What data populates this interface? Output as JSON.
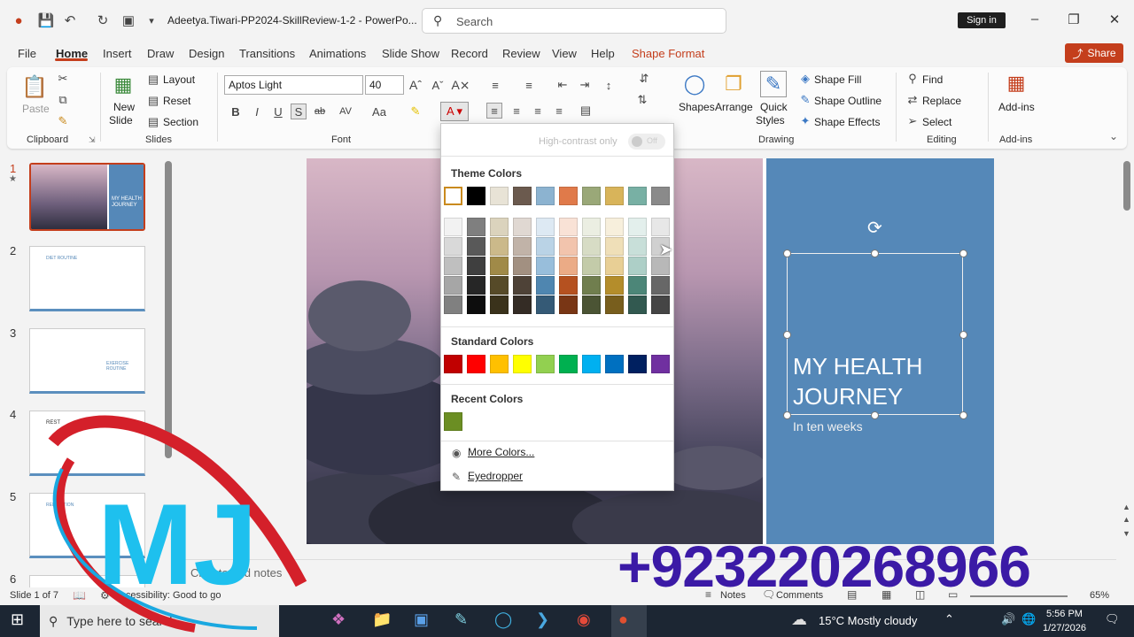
{
  "app": {
    "document_title": "Adeetya.Tiwari-PP2024-SkillReview-1-2  -  PowerPo...",
    "search_placeholder": "Search",
    "sign_in": "Sign in"
  },
  "menu": {
    "tabs": [
      "File",
      "Home",
      "Insert",
      "Draw",
      "Design",
      "Transitions",
      "Animations",
      "Slide Show",
      "Record",
      "Review",
      "View",
      "Help",
      "Shape Format"
    ],
    "share": "Share"
  },
  "ribbon": {
    "clipboard": {
      "paste": "Paste",
      "group": "Clipboard"
    },
    "slides": {
      "new_slide_1": "New",
      "new_slide_2": "Slide",
      "layout": "Layout",
      "reset": "Reset",
      "section": "Section",
      "group": "Slides"
    },
    "font": {
      "name": "Aptos Light",
      "size": "40",
      "group": "Font"
    },
    "drawing": {
      "shapes": "Shapes",
      "arrange": "Arrange",
      "quick_styles_1": "Quick",
      "quick_styles_2": "Styles",
      "shape_fill": "Shape Fill",
      "shape_outline": "Shape Outline",
      "shape_effects": "Shape Effects",
      "group": "Drawing"
    },
    "editing": {
      "find": "Find",
      "replace": "Replace",
      "select": "Select",
      "group": "Editing"
    },
    "addins": {
      "label": "Add-ins",
      "group": "Add-ins"
    }
  },
  "thumbnails": [
    {
      "num": "1",
      "title": "MY HEALTH JOURNEY"
    },
    {
      "num": "2",
      "title": "DIET ROUTINE"
    },
    {
      "num": "3",
      "title": "EXERCISE ROUTINE"
    },
    {
      "num": "4",
      "title": "REST"
    },
    {
      "num": "5",
      "title": "RELAXATION"
    },
    {
      "num": "6",
      "title": ""
    }
  ],
  "slide": {
    "title": "MY HEALTH JOURNEY",
    "subtitle": "In ten weeks",
    "notes_placeholder": "Click to add notes"
  },
  "palette": {
    "high_contrast": "High-contrast only",
    "toggle": "Off",
    "theme_header": "Theme Colors",
    "standard_header": "Standard Colors",
    "recent_header": "Recent Colors",
    "more_colors": "More Colors...",
    "eyedropper": "Eyedropper",
    "theme_top": [
      "#ffffff",
      "#000000",
      "#e8e3d6",
      "#6b5a4e",
      "#8cb3d0",
      "#e07a4a",
      "#9aa878",
      "#d8b45a",
      "#78b0a4",
      "#8a8a8a"
    ],
    "theme_shades": [
      [
        "#f2f2f2",
        "#7f7f7f",
        "#dbd3bd",
        "#e0d8d2",
        "#dde9f3",
        "#f9e2d6",
        "#ebeee2",
        "#f7efdc",
        "#e3efec",
        "#e7e7e7"
      ],
      [
        "#d9d9d9",
        "#595959",
        "#cbb98a",
        "#c1b3a8",
        "#bad3e6",
        "#f2c4ad",
        "#d7dcc5",
        "#efdfb8",
        "#c8dfd9",
        "#d0d0d0"
      ],
      [
        "#bfbfbf",
        "#3f3f3f",
        "#a08a48",
        "#a29081",
        "#98bedb",
        "#ebab86",
        "#c3cba9",
        "#e8cf95",
        "#adcfc7",
        "#b8b8b8"
      ],
      [
        "#a6a6a6",
        "#262626",
        "#564a28",
        "#4e4237",
        "#4f86b0",
        "#b55120",
        "#707e4e",
        "#b48d2b",
        "#4c8678",
        "#676767"
      ],
      [
        "#808080",
        "#0d0d0d",
        "#3a321b",
        "#342c25",
        "#355a76",
        "#793615",
        "#4b5434",
        "#785e1d",
        "#325950",
        "#454545"
      ]
    ],
    "standard": [
      "#c00000",
      "#ff0000",
      "#ffc000",
      "#ffff00",
      "#92d050",
      "#00b050",
      "#00b0f0",
      "#0070c0",
      "#002060",
      "#7030a0"
    ],
    "recent": [
      "#6b8e23"
    ]
  },
  "status": {
    "slide_of": "Slide 1 of 7",
    "accessibility": "Accessibility: Good to go",
    "notes": "Notes",
    "comments": "Comments",
    "zoom": "65%"
  },
  "taskbar": {
    "search": "Type here to search",
    "weather": "15°C  Mostly cloudy",
    "time": "5:56 PM",
    "date": "1/27/2026"
  },
  "overlay": {
    "phone": "+923220268966",
    "logo": "MJ"
  }
}
